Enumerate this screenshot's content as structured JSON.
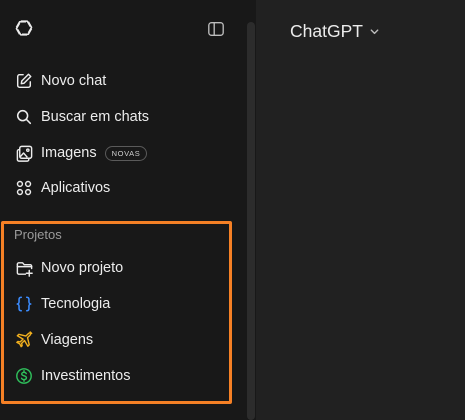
{
  "sidebar": {
    "items": [
      {
        "label": "Novo chat",
        "icon": "compose-icon"
      },
      {
        "label": "Buscar em chats",
        "icon": "search-icon"
      },
      {
        "label": "Imagens",
        "icon": "images-icon",
        "badge": "NOVAS"
      },
      {
        "label": "Aplicativos",
        "icon": "apps-icon"
      }
    ],
    "projects": {
      "title": "Projetos",
      "items": [
        {
          "label": "Novo projeto",
          "icon": "folder-plus-icon"
        },
        {
          "label": "Tecnologia",
          "icon": "braces-icon",
          "color": "#3b8cff"
        },
        {
          "label": "Viagens",
          "icon": "airplane-icon",
          "color": "#f2b01e"
        },
        {
          "label": "Investimentos",
          "icon": "dollar-icon",
          "color": "#2fbf5b"
        }
      ]
    }
  },
  "header": {
    "model_name": "ChatGPT"
  },
  "colors": {
    "highlight": "#f58025",
    "sidebar_bg": "#181818",
    "main_bg": "#212121"
  }
}
